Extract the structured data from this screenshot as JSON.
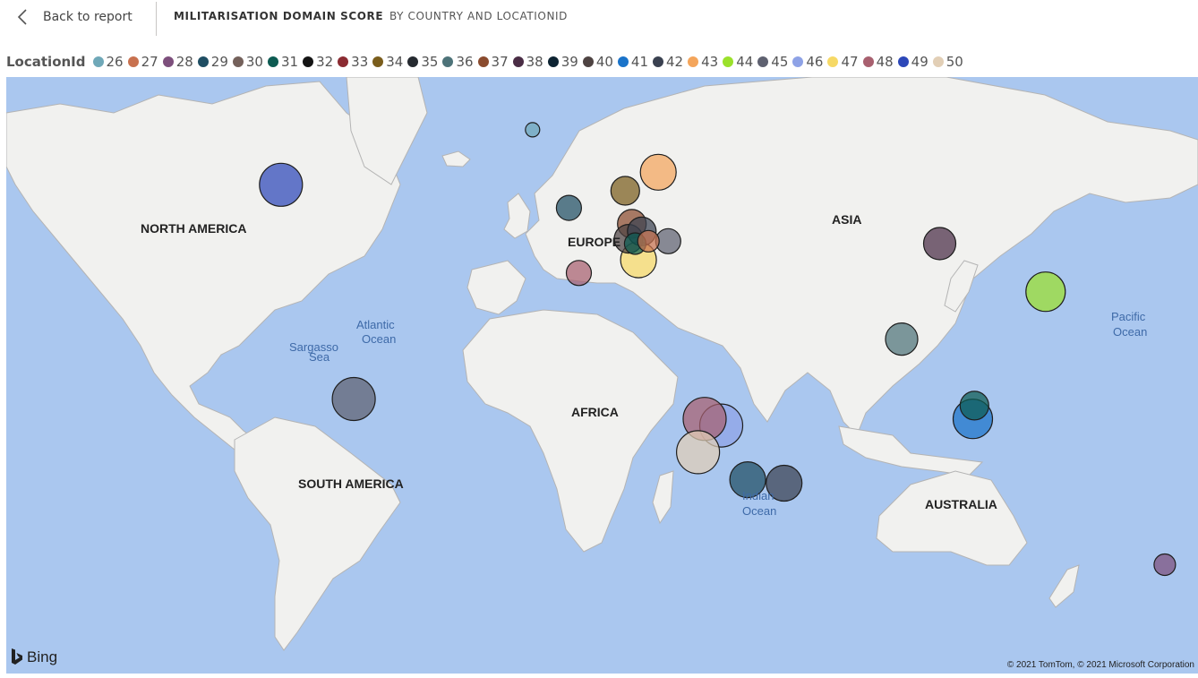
{
  "header": {
    "back_label": "Back to report",
    "title": "MILITARISATION DOMAIN SCORE",
    "subtitle": "BY COUNTRY AND LOCATIONID"
  },
  "legend": {
    "title": "LocationId",
    "items": [
      {
        "id": "26",
        "color": "#6fa8b8"
      },
      {
        "id": "27",
        "color": "#c8714f"
      },
      {
        "id": "28",
        "color": "#7d4f7c"
      },
      {
        "id": "29",
        "color": "#1f4e63"
      },
      {
        "id": "30",
        "color": "#74615b"
      },
      {
        "id": "31",
        "color": "#0d5b52"
      },
      {
        "id": "32",
        "color": "#141414"
      },
      {
        "id": "33",
        "color": "#8b2b32"
      },
      {
        "id": "34",
        "color": "#7a5d1c"
      },
      {
        "id": "35",
        "color": "#252a30"
      },
      {
        "id": "36",
        "color": "#4d7379"
      },
      {
        "id": "37",
        "color": "#8a4b2e"
      },
      {
        "id": "38",
        "color": "#4a2d45"
      },
      {
        "id": "39",
        "color": "#0d2332"
      },
      {
        "id": "40",
        "color": "#4e4342"
      },
      {
        "id": "41",
        "color": "#1a73c9"
      },
      {
        "id": "42",
        "color": "#3a4150"
      },
      {
        "id": "43",
        "color": "#f4a55b"
      },
      {
        "id": "44",
        "color": "#9be12b"
      },
      {
        "id": "45",
        "color": "#5e6170"
      },
      {
        "id": "46",
        "color": "#8ea2e6"
      },
      {
        "id": "47",
        "color": "#f6d966"
      },
      {
        "id": "48",
        "color": "#a8606f"
      },
      {
        "id": "49",
        "color": "#2c47b8"
      },
      {
        "id": "50",
        "color": "#e2cfb6"
      }
    ]
  },
  "map": {
    "labels": {
      "north_america": "NORTH AMERICA",
      "south_america": "SOUTH AMERICA",
      "europe": "EUROPE",
      "africa": "AFRICA",
      "asia": "ASIA",
      "australia": "AUSTRALIA",
      "atlantic_1": "Atlantic",
      "atlantic_2": "Ocean",
      "sargasso_1": "Sargasso",
      "sargasso_2": "Sea",
      "pacific_1": "Pacific",
      "pacific_2": "Ocean",
      "indian_1": "Indian",
      "indian_2": "Ocean"
    },
    "bubbles": [
      {
        "location_id": "49",
        "lon": -95,
        "lat": 57,
        "size": 5
      },
      {
        "location_id": "26",
        "lon": -19,
        "lat": 65,
        "size": 1
      },
      {
        "location_id": "34",
        "lon": 9,
        "lat": 56,
        "size": 3
      },
      {
        "location_id": "43",
        "lon": 19,
        "lat": 59,
        "size": 4
      },
      {
        "location_id": "29",
        "lon": -8,
        "lat": 53,
        "size": 2.5
      },
      {
        "location_id": "37",
        "lon": 11,
        "lat": 50,
        "size": 3
      },
      {
        "location_id": "40",
        "lon": 10,
        "lat": 47,
        "size": 3
      },
      {
        "location_id": "42",
        "lon": 14,
        "lat": 48.5,
        "size": 3
      },
      {
        "location_id": "31",
        "lon": 12,
        "lat": 46,
        "size": 2
      },
      {
        "location_id": "27",
        "lon": 16,
        "lat": 46.5,
        "size": 2
      },
      {
        "location_id": "45",
        "lon": 22,
        "lat": 46.5,
        "size": 2.5
      },
      {
        "location_id": "47",
        "lon": 13,
        "lat": 42.5,
        "size": 4
      },
      {
        "location_id": "48",
        "lon": -5,
        "lat": 39.5,
        "size": 2.5
      },
      {
        "location_id": "38",
        "lon": 104,
        "lat": 46,
        "size": 3.5
      },
      {
        "location_id": "44",
        "lon": 136,
        "lat": 35,
        "size": 4.5
      },
      {
        "location_id": "36",
        "lon": 92.5,
        "lat": 22.5,
        "size": 3.5
      },
      {
        "location_id": "45",
        "lon": -73,
        "lat": 5,
        "size": 5
      },
      {
        "location_id": "46",
        "lon": 38,
        "lat": -3,
        "size": 5
      },
      {
        "location_id": "48",
        "lon": 33,
        "lat": -1,
        "size": 5
      },
      {
        "location_id": "50",
        "lon": 31,
        "lat": -11,
        "size": 5
      },
      {
        "location_id": "29",
        "lon": 46,
        "lat": -19,
        "size": 4
      },
      {
        "location_id": "42",
        "lon": 57,
        "lat": -20,
        "size": 4
      },
      {
        "location_id": "41",
        "lon": 114,
        "lat": -1,
        "size": 4.5
      },
      {
        "location_id": "31",
        "lon": 114.5,
        "lat": 3,
        "size": 3
      },
      {
        "location_id": "28",
        "lon": 172,
        "lat": -41,
        "size": 2
      }
    ]
  },
  "footer": {
    "bing_label": "Bing",
    "copyright": "© 2021 TomTom, © 2021 Microsoft Corporation"
  }
}
